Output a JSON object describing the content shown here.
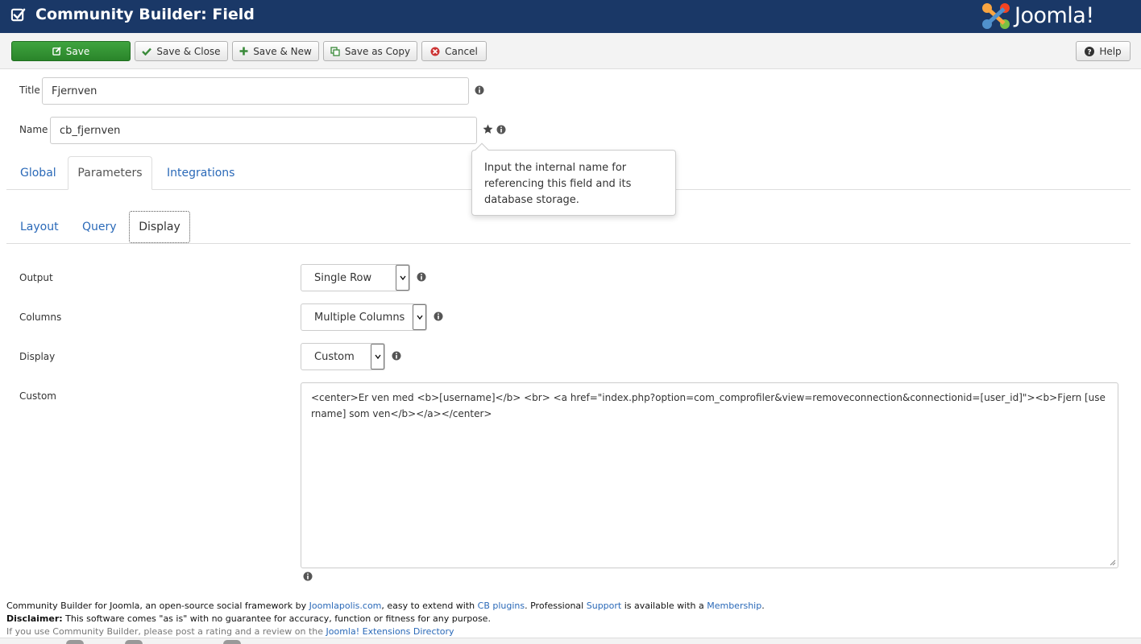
{
  "header": {
    "title": "Community Builder: Field",
    "logo_text": "Joomla!"
  },
  "toolbar": {
    "save": "Save",
    "save_close": "Save & Close",
    "save_new": "Save & New",
    "save_copy": "Save as Copy",
    "cancel": "Cancel",
    "help": "Help"
  },
  "form": {
    "title_label": "Title",
    "title_value": "Fjernven",
    "name_label": "Name",
    "name_value": "cb_fjernven"
  },
  "tooltip": {
    "text": "Input the internal name for referencing this field and its database storage."
  },
  "main_tabs": [
    {
      "label": "Global"
    },
    {
      "label": "Parameters"
    },
    {
      "label": "Integrations"
    }
  ],
  "sub_tabs": [
    {
      "label": "Layout"
    },
    {
      "label": "Query"
    },
    {
      "label": "Display"
    }
  ],
  "display": {
    "output_label": "Output",
    "output_value": "Single Row",
    "columns_label": "Columns",
    "columns_value": "Multiple Columns",
    "display_label": "Display",
    "display_value": "Custom",
    "custom_label": "Custom",
    "custom_value": "<center>Er ven med <b>[username]</b>   <br>   <a href=\"index.php?option=com_comprofiler&view=removeconnection&connectionid=[user_id]\"><b>Fjern [username] som ven</b></a></center>"
  },
  "footer": {
    "line1_a": "Community Builder for Joomla, an open-source social framework by ",
    "line1_link1": "Joomlapolis.com",
    "line1_b": ", easy to extend with ",
    "line1_link2": "CB plugins",
    "line1_c": ". Professional ",
    "line1_link3": "Support",
    "line1_d": " is available with a ",
    "line1_link4": "Membership",
    "line1_e": ".",
    "line2_bold": "Disclaimer:",
    "line2_text": " This software comes \"as is\" with no guarantee for accuracy, function or fitness for any purpose.",
    "line3_text": "If you use Community Builder, please post a rating and a review on the ",
    "line3_link": "Joomla! Extensions Directory"
  },
  "colors": {
    "header_bg": "#1a3867",
    "save_green": "#2f8f2f",
    "link_blue": "#2a69b8"
  }
}
